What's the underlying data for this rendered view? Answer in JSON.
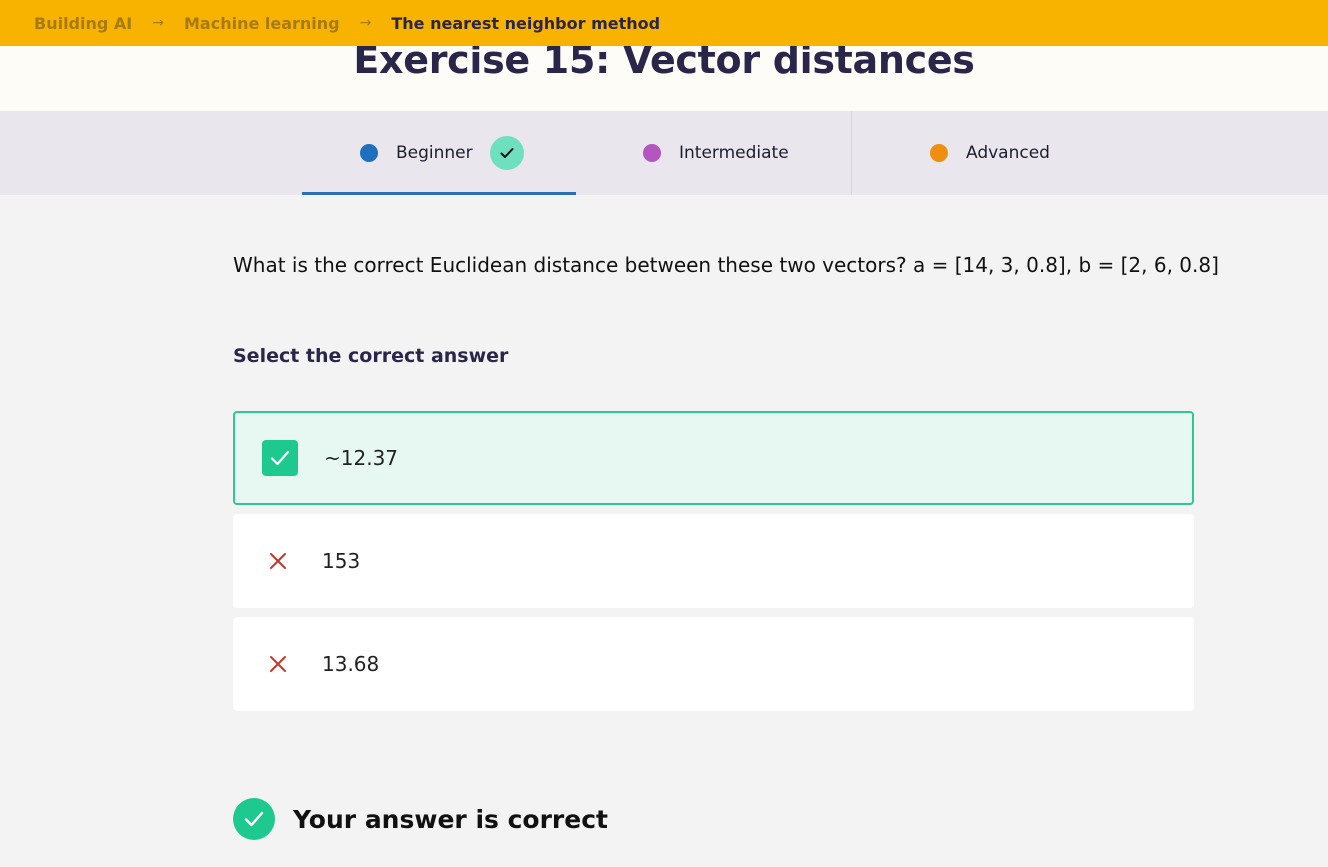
{
  "breadcrumb": {
    "items": [
      {
        "label": "Building AI"
      },
      {
        "label": "Machine learning"
      }
    ],
    "arrow": "→",
    "current": "The nearest neighbor method"
  },
  "page": {
    "title": "Exercise 15: Vector distances"
  },
  "tabs": [
    {
      "label": "Beginner",
      "dot_color": "#1f6fbf",
      "completed": true,
      "active": true
    },
    {
      "label": "Intermediate",
      "dot_color": "#b555c0",
      "completed": false,
      "active": false
    },
    {
      "label": "Advanced",
      "dot_color": "#ef8f12",
      "completed": false,
      "active": false
    }
  ],
  "question": {
    "text": "What is the correct Euclidean distance between these two vectors? a = [14, 3, 0.8], b = [2, 6, 0.8]",
    "select_label": "Select the correct answer"
  },
  "options": [
    {
      "label": "~12.37",
      "status": "correct",
      "icon": "check-icon"
    },
    {
      "label": "153",
      "status": "wrong",
      "icon": "cross-icon"
    },
    {
      "label": "13.68",
      "status": "wrong",
      "icon": "cross-icon"
    }
  ],
  "result": {
    "text": "Your answer is correct",
    "icon": "check-circle-icon"
  },
  "colors": {
    "topbar": "#f8b300",
    "accent_green": "#1ec98f",
    "wrong_red": "#c0392b",
    "title": "#29264a"
  }
}
